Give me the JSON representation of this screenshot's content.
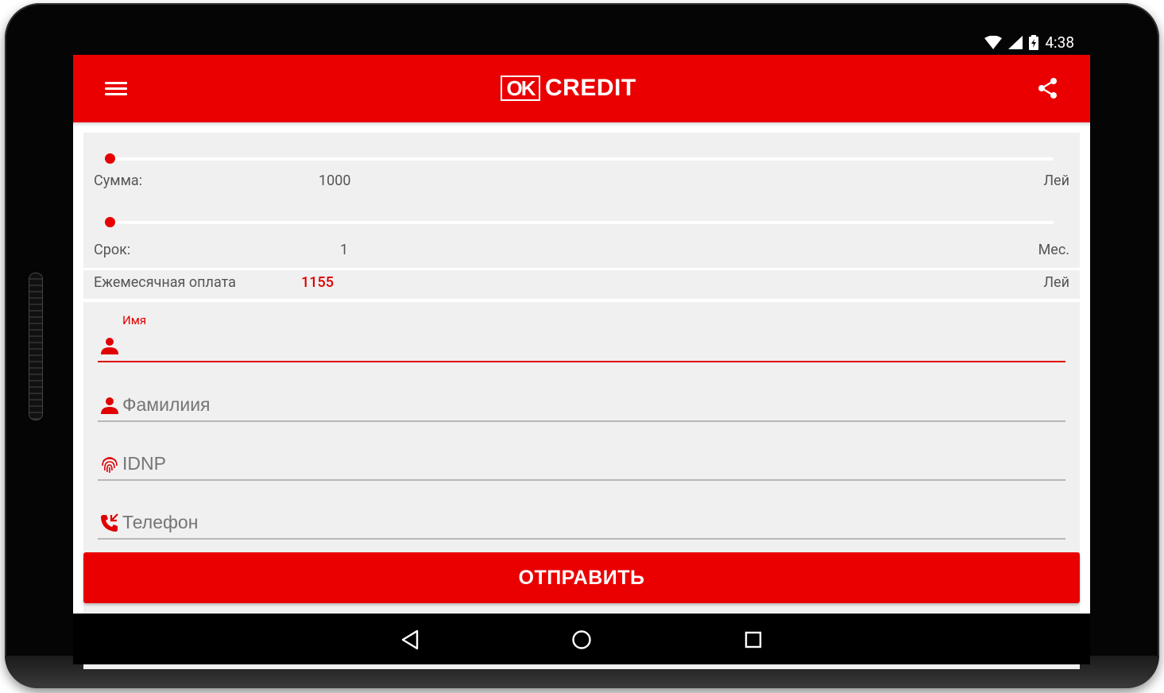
{
  "status": {
    "time": "4:38"
  },
  "appbar": {
    "logo_mark": "OK",
    "logo_text": "CREDIT"
  },
  "calculator": {
    "amount": {
      "label": "Сумма:",
      "value": "1000",
      "unit": "Лей",
      "slider_level": 0
    },
    "term": {
      "label": "Срок:",
      "value": "1",
      "unit": "Мес.",
      "slider_level": 0
    },
    "monthly": {
      "label": "Ежемесячная оплата",
      "value": "1155",
      "unit": "Лей"
    }
  },
  "form": {
    "first_name": {
      "floating_label": "Имя",
      "value": ""
    },
    "last_name": {
      "placeholder": "Фамилиия"
    },
    "idnp": {
      "placeholder": "IDNP"
    },
    "phone": {
      "placeholder": "Телефон"
    }
  },
  "submit_label": "ОТПРАВИТЬ",
  "colors": {
    "accent": "#ea0000",
    "card": "#f0f0f0",
    "text": "#555555"
  },
  "icons": [
    "menu-icon",
    "share-icon",
    "person-icon",
    "fingerprint-icon",
    "phone-icon",
    "back-icon",
    "home-icon",
    "recents-icon",
    "wifi-icon",
    "signal-icon",
    "battery-icon"
  ]
}
